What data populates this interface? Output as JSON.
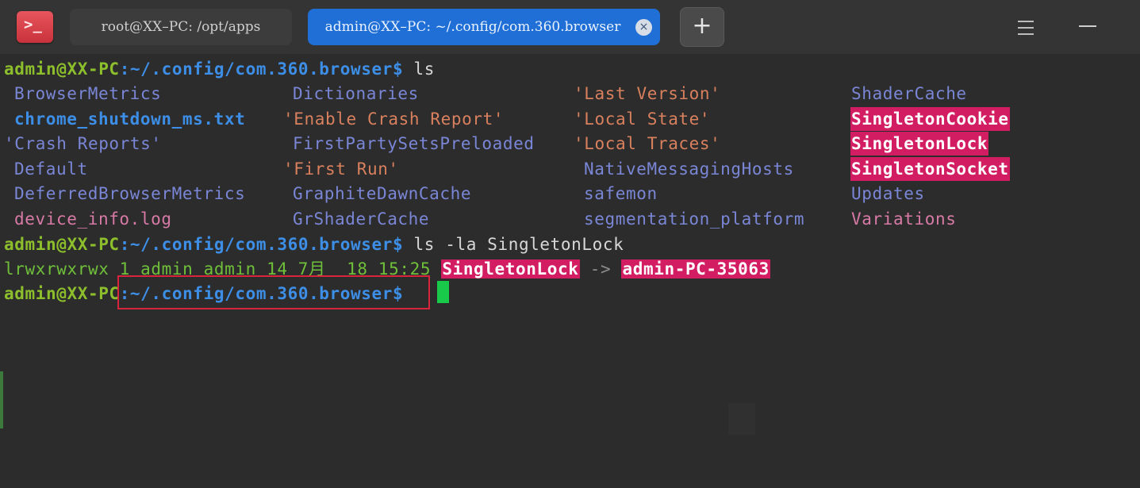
{
  "titlebar": {
    "app_icon_glyph": ">_",
    "tabs": [
      {
        "label": "root@XX–PC:  /opt/apps",
        "active": false
      },
      {
        "label": "admin@XX–PC:  ~/.config/com.360.browser",
        "active": true,
        "close_glyph": "×"
      }
    ],
    "new_tab_label": "+",
    "menu_icon": "hamburger-menu-icon",
    "minimize_icon": "minimize-icon"
  },
  "terminal": {
    "prompt_user": "admin@XX-PC",
    "prompt_path": ":~/.config/com.360.browser$",
    "commands": {
      "first": " ls",
      "second": " ls -la SingletonLock"
    },
    "listing": {
      "col1": [
        "BrowserMetrics",
        "chrome_shutdown_ms.txt",
        "'Crash Reports'",
        "Default",
        "DeferredBrowserMetrics",
        "device_info.log"
      ],
      "col2": [
        "Dictionaries",
        "'Enable Crash Report'",
        "FirstPartySetsPreloaded",
        "'First Run'",
        "GraphiteDawnCache",
        "GrShaderCache"
      ],
      "col3": [
        "'Last Version'",
        "'Local State'",
        "'Local Traces'",
        "NativeMessagingHosts",
        "safemon",
        "segmentation_platform"
      ],
      "col4": [
        "ShaderCache",
        "SingletonCookie",
        "SingletonLock",
        "SingletonSocket",
        "Updates",
        "Variations"
      ]
    },
    "ls_la_output": {
      "perms": "lrwxrwxrwx 1 admin admin 14 7月  18 15:25 ",
      "link_name": "SingletonLock",
      "arrow": " -> ",
      "target": "admin-PC-35063"
    },
    "colors": {
      "background": "#2c2c2c",
      "prompt_user": "#8dbf2c",
      "prompt_path": "#3d8ee6",
      "special_bg": "#d31d62",
      "cursor": "#19c94a",
      "highlight_box": "#d8243c"
    }
  }
}
